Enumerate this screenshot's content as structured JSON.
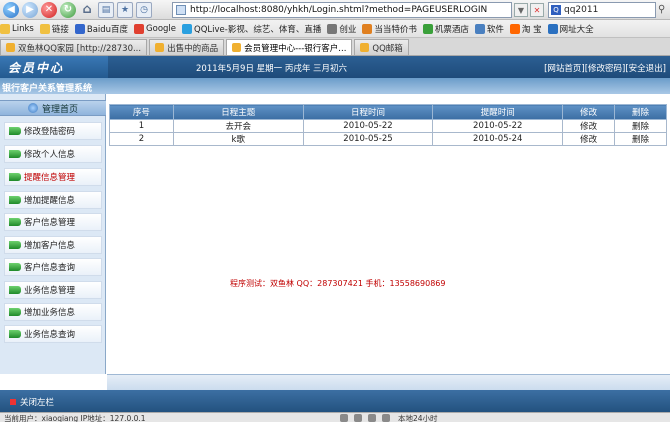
{
  "browser": {
    "url": "http://localhost:8080/yhkh/Login.shtml?method=PAGEUSERLOGIN",
    "search_value": "qq2011",
    "links": [
      {
        "label": "Links",
        "color": "#f0c040"
      },
      {
        "label": "链接",
        "color": "#f0c040"
      },
      {
        "label": "Baidu百度",
        "color": "#3366cc"
      },
      {
        "label": "Google",
        "color": "#e04030"
      },
      {
        "label": "QQLive-影视、综艺、体育、直播",
        "color": "#2aa0e0"
      },
      {
        "label": "创业",
        "color": "#777777"
      },
      {
        "label": "当当特价书",
        "color": "#e08020"
      },
      {
        "label": "机票酒店",
        "color": "#3aa03a"
      },
      {
        "label": "软件",
        "color": "#4a80c0"
      },
      {
        "label": "淘 宝",
        "color": "#ff6600"
      },
      {
        "label": "网址大全",
        "color": "#2a70c0"
      }
    ],
    "tabs": [
      {
        "label": "双鱼林QQ家园 [http://28730..."
      },
      {
        "label": "出售中的商品"
      },
      {
        "label": "会员管理中心---银行客户..."
      },
      {
        "label": "QQ邮箱"
      }
    ]
  },
  "header": {
    "logo": "会员中心",
    "date": "2011年5月9日 星期一 丙戌年 三月初六",
    "links": [
      "[网站首页]",
      "[修改密码]",
      "[安全退出]"
    ],
    "system_title": "银行客户关系管理系统"
  },
  "sidebar": {
    "home": "管理首页",
    "items": [
      {
        "label": "修改登陆密码",
        "active": false
      },
      {
        "label": "修改个人信息",
        "active": false
      },
      {
        "label": "提醒信息管理",
        "active": true
      },
      {
        "label": "增加提醒信息",
        "active": false
      },
      {
        "label": "客户信息管理",
        "active": false
      },
      {
        "label": "增加客户信息",
        "active": false
      },
      {
        "label": "客户信息查询",
        "active": false
      },
      {
        "label": "业务信息管理",
        "active": false
      },
      {
        "label": "增加业务信息",
        "active": false
      },
      {
        "label": "业务信息查询",
        "active": false
      }
    ]
  },
  "table": {
    "headers": [
      "序号",
      "日程主题",
      "日程时间",
      "提醒时间",
      "修改",
      "删除"
    ],
    "rows": [
      [
        "1",
        "去开会",
        "2010-05-22",
        "2010-05-22",
        "修改",
        "删除"
      ],
      [
        "2",
        "k歌",
        "2010-05-25",
        "2010-05-24",
        "修改",
        "删除"
      ]
    ]
  },
  "credit": "程序测试：双鱼林  QQ：287307421  手机：13558690869",
  "footer": {
    "close_label": "关闭左栏"
  },
  "statusbar": {
    "user": "当前用户：xiaoqiang  IP地址：127.0.0.1",
    "net": "本地24小时"
  }
}
